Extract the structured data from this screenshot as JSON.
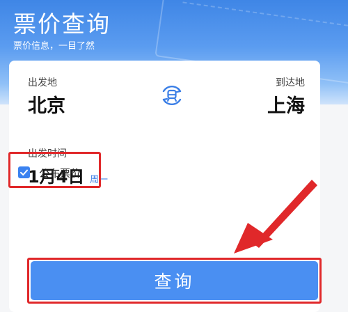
{
  "header": {
    "title": "票价查询",
    "subtitle": "票价信息，一目了然"
  },
  "route": {
    "from_label": "出发地",
    "from_city": "北京",
    "to_label": "到达地",
    "to_city": "上海",
    "swap_icon": "train-swap-icon"
  },
  "departure": {
    "label": "出发时间",
    "date": "1月4日",
    "weekday": "周一"
  },
  "options": {
    "published_fare_label": "公布票价",
    "published_fare_checked": true
  },
  "actions": {
    "search_label": "查询"
  },
  "colors": {
    "accent": "#4a8ff2",
    "highlight": "#e0282a",
    "weekday": "#3a7ee6"
  }
}
